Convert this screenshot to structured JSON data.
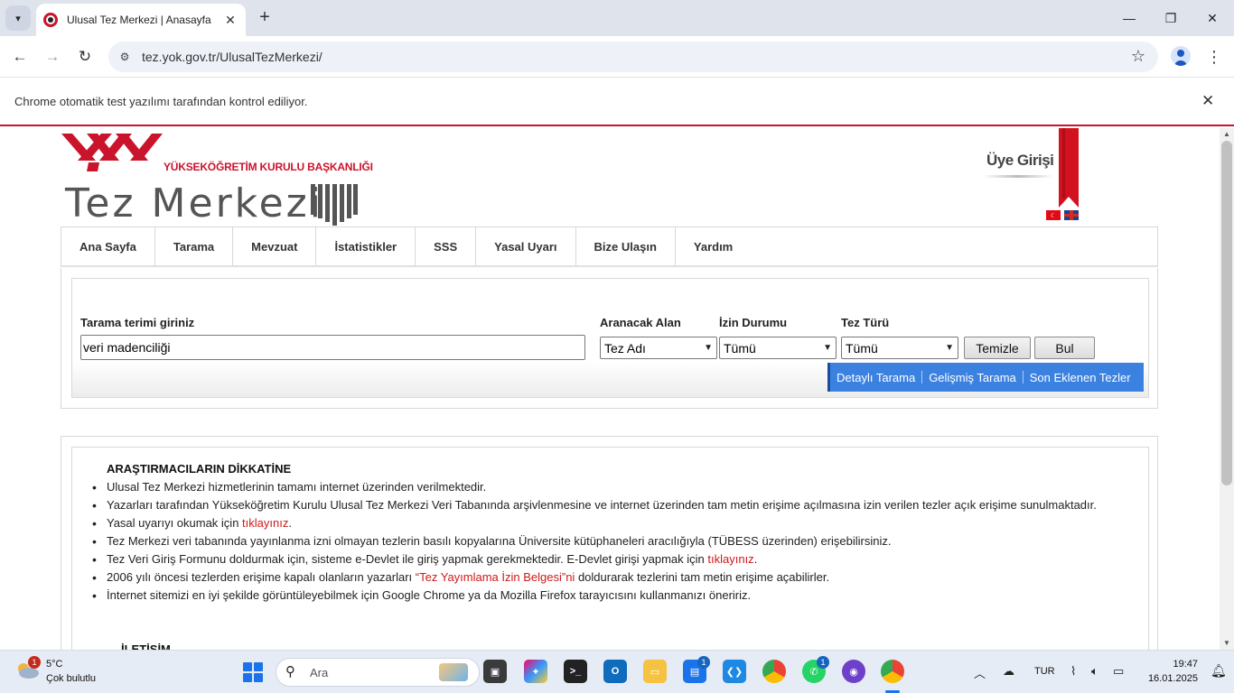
{
  "browser": {
    "tab_title": "Ulusal Tez Merkezi | Anasayfa",
    "url": "tez.yok.gov.tr/UlusalTezMerkezi/",
    "infobar_text": "Chrome otomatik test yazılımı tarafından kontrol ediliyor."
  },
  "header": {
    "institution": "YÜKSEKÖĞRETİM KURULU BAŞKANLIĞI",
    "site_name": "Tez Merkezi",
    "member_login": "Üye Girişi"
  },
  "nav": {
    "items": [
      "Ana Sayfa",
      "Tarama",
      "Mevzuat",
      "İstatistikler",
      "SSS",
      "Yasal Uyarı",
      "Bize Ulaşın",
      "Yardım"
    ]
  },
  "search": {
    "term_label": "Tarama terimi giriniz",
    "term_value": "veri madenciliği",
    "field_label": "Aranacak Alan",
    "field_value": "Tez Adı",
    "permission_label": "İzin Durumu",
    "permission_value": "Tümü",
    "type_label": "Tez Türü",
    "type_value": "Tümü",
    "clear_button": "Temizle",
    "find_button": "Bul",
    "links": [
      "Detaylı Tarama",
      "Gelişmiş Tarama",
      "Son Eklenen Tezler"
    ]
  },
  "notice": {
    "title": "ARAŞTIRMACILARIN DİKKATİNE",
    "item1": "Ulusal Tez Merkezi hizmetlerinin tamamı internet üzerinden verilmektedir.",
    "item2": "Yazarları tarafından Yükseköğretim Kurulu Ulusal Tez Merkezi Veri Tabanında arşivlenmesine ve internet üzerinden tam metin erişime açılmasına izin verilen tezler açık erişime sunulmaktadır.",
    "item3_pre": "Yasal uyarıyı okumak için ",
    "item3_link": "tıklayınız",
    "item3_post": ".",
    "item4": "Tez Merkezi veri tabanında yayınlanma izni olmayan tezlerin basılı kopyalarına Üniversite kütüphaneleri aracılığıyla (TÜBESS üzerinden) erişebilirsiniz.",
    "item5_pre": "Tez Veri Giriş Formunu doldurmak için, sisteme e-Devlet ile giriş yapmak gerekmektedir. E-Devlet girişi yapmak için ",
    "item5_link": "tıklayınız",
    "item5_post": ".",
    "item6_pre": "2006 yılı öncesi tezlerden erişime kapalı olanların yazarları ",
    "item6_link": "“Tez Yayımlama İzin Belgesi”ni",
    "item6_post": " doldurarak tezlerini tam metin erişime açabilirler.",
    "item7": "İnternet sitemizi en iyi şekilde görüntüleyebilmek için Google Chrome ya da Mozilla Firefox tarayıcısını kullanmanızı öneririz.",
    "contact_title": "İLETİŞİM"
  },
  "taskbar": {
    "weather_temp": "5°C",
    "weather_desc": "Çok bulutlu",
    "weather_badge": "1",
    "search_placeholder": "Ara",
    "outlook_badge": "1",
    "whatsapp_badge": "1",
    "language": "TUR",
    "time": "19:47",
    "date": "16.01.2025"
  }
}
